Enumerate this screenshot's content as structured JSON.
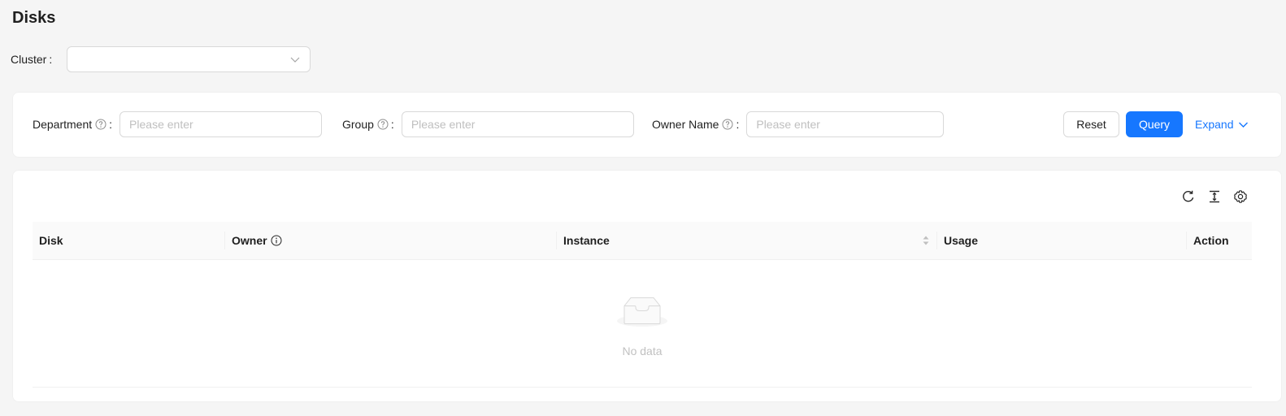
{
  "page": {
    "title": "Disks"
  },
  "cluster": {
    "label": "Cluster",
    "colon": ":",
    "value": ""
  },
  "filters": {
    "department": {
      "label": "Department",
      "placeholder": "Please enter"
    },
    "group": {
      "label": "Group",
      "placeholder": "Please enter"
    },
    "owner_name": {
      "label": "Owner Name",
      "placeholder": "Please enter"
    },
    "colon": ":",
    "reset_label": "Reset",
    "query_label": "Query",
    "expand_label": "Expand"
  },
  "toolbar": {
    "icons": [
      "reload-icon",
      "column-height-icon",
      "setting-icon"
    ]
  },
  "table": {
    "columns": [
      "Disk",
      "Owner",
      "Instance",
      "Usage",
      "Action"
    ],
    "rows": [],
    "empty_text": "No data"
  },
  "colors": {
    "primary": "#1677ff",
    "background": "#f5f5f5",
    "border": "#d9d9d9"
  }
}
